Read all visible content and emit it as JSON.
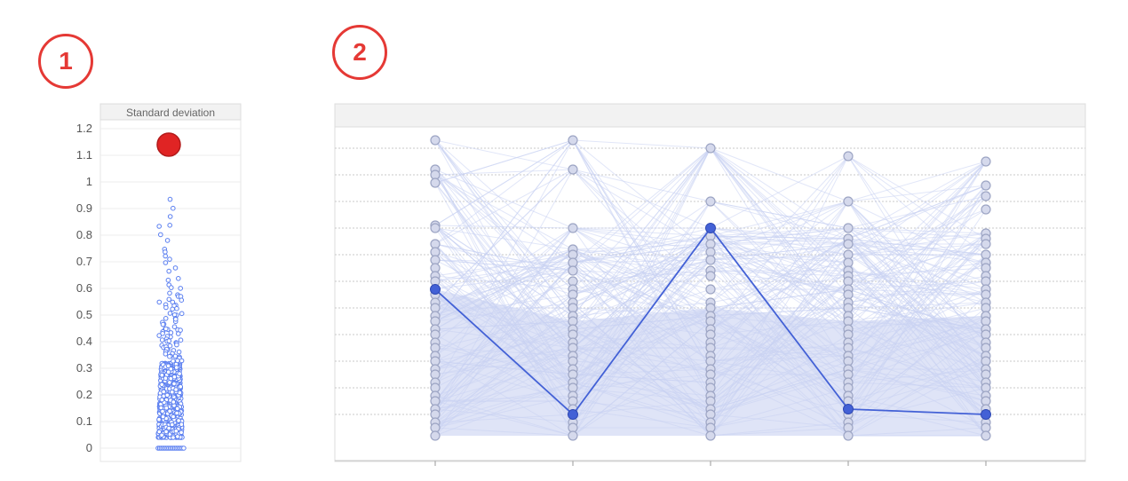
{
  "badges": [
    "1",
    "2"
  ],
  "colors": {
    "outlier": "#e02424",
    "dots": "#5b7ff0",
    "pc_lines": "#c9d1f2",
    "pc_highlight": "#4361d6",
    "pc_nodes_fill": "#d5d9ec",
    "pc_nodes_stroke": "#9da5c4"
  },
  "chart_data": [
    {
      "type": "scatter",
      "title": "Standard deviation",
      "ylim": [
        0,
        1.2
      ],
      "yticks": [
        "0",
        "0.1",
        "0.2",
        "0.3",
        "0.4",
        "0.5",
        "0.6",
        "0.7",
        "0.8",
        "0.9",
        "1",
        "1.1",
        "1.2"
      ],
      "grid": true,
      "outlier": {
        "y": 1.14,
        "color": "#e02424"
      },
      "distribution": {
        "dense_range": [
          0.04,
          0.32
        ],
        "zero_cluster": 0,
        "sparse_values": [
          0.93,
          0.9,
          0.87,
          0.84,
          0.83,
          0.8,
          0.78,
          0.75,
          0.74,
          0.72,
          0.71,
          0.7,
          0.68,
          0.66,
          0.64,
          0.63,
          0.61,
          0.6,
          0.58,
          0.57,
          0.56,
          0.55,
          0.54,
          0.53,
          0.52,
          0.51,
          0.5,
          0.49,
          0.48,
          0.47,
          0.46,
          0.45,
          0.44,
          0.43,
          0.42,
          0.41,
          0.4,
          0.39,
          0.38,
          0.37,
          0.36,
          0.35,
          0.34,
          0.33
        ]
      }
    },
    {
      "type": "line",
      "subtype": "parallel-coordinates",
      "axes_count": 5,
      "ylim": [
        0,
        1.2
      ],
      "gridlines": [
        0.1,
        0.2,
        0.3,
        0.4,
        0.5,
        0.6,
        0.7,
        0.8,
        0.9,
        1.0,
        1.1
      ],
      "highlighted": [
        0.57,
        0.1,
        0.8,
        0.12,
        0.1
      ],
      "axis_nodes": [
        [
          1.13,
          1.02,
          1.0,
          0.97,
          0.81,
          0.8,
          0.74,
          0.71,
          0.68,
          0.65,
          0.62,
          0.6,
          0.57,
          0.55,
          0.52,
          0.5,
          0.47,
          0.45,
          0.42,
          0.4,
          0.37,
          0.35,
          0.32,
          0.3,
          0.27,
          0.25,
          0.22,
          0.2,
          0.17,
          0.15,
          0.12,
          0.1,
          0.07,
          0.05,
          0.02
        ],
        [
          1.13,
          1.02,
          0.8,
          0.72,
          0.7,
          0.67,
          0.64,
          0.6,
          0.57,
          0.55,
          0.52,
          0.5,
          0.47,
          0.45,
          0.42,
          0.4,
          0.37,
          0.35,
          0.32,
          0.3,
          0.27,
          0.25,
          0.22,
          0.2,
          0.17,
          0.15,
          0.12,
          0.1,
          0.07,
          0.05,
          0.02
        ],
        [
          1.1,
          0.9,
          0.8,
          0.77,
          0.74,
          0.71,
          0.68,
          0.64,
          0.62,
          0.57,
          0.52,
          0.5,
          0.47,
          0.45,
          0.42,
          0.4,
          0.37,
          0.35,
          0.32,
          0.3,
          0.27,
          0.25,
          0.22,
          0.2,
          0.17,
          0.15,
          0.12,
          0.1,
          0.07,
          0.05,
          0.02
        ],
        [
          1.07,
          0.9,
          0.8,
          0.76,
          0.74,
          0.7,
          0.67,
          0.64,
          0.62,
          0.6,
          0.57,
          0.55,
          0.52,
          0.5,
          0.47,
          0.45,
          0.42,
          0.4,
          0.37,
          0.35,
          0.32,
          0.3,
          0.27,
          0.25,
          0.22,
          0.2,
          0.17,
          0.15,
          0.12,
          0.1,
          0.07,
          0.05,
          0.02
        ],
        [
          1.05,
          0.96,
          0.92,
          0.87,
          0.78,
          0.76,
          0.74,
          0.7,
          0.67,
          0.65,
          0.62,
          0.6,
          0.57,
          0.55,
          0.52,
          0.5,
          0.47,
          0.45,
          0.42,
          0.4,
          0.37,
          0.35,
          0.32,
          0.3,
          0.27,
          0.25,
          0.22,
          0.2,
          0.17,
          0.15,
          0.12,
          0.1,
          0.07,
          0.05,
          0.02
        ]
      ]
    }
  ]
}
